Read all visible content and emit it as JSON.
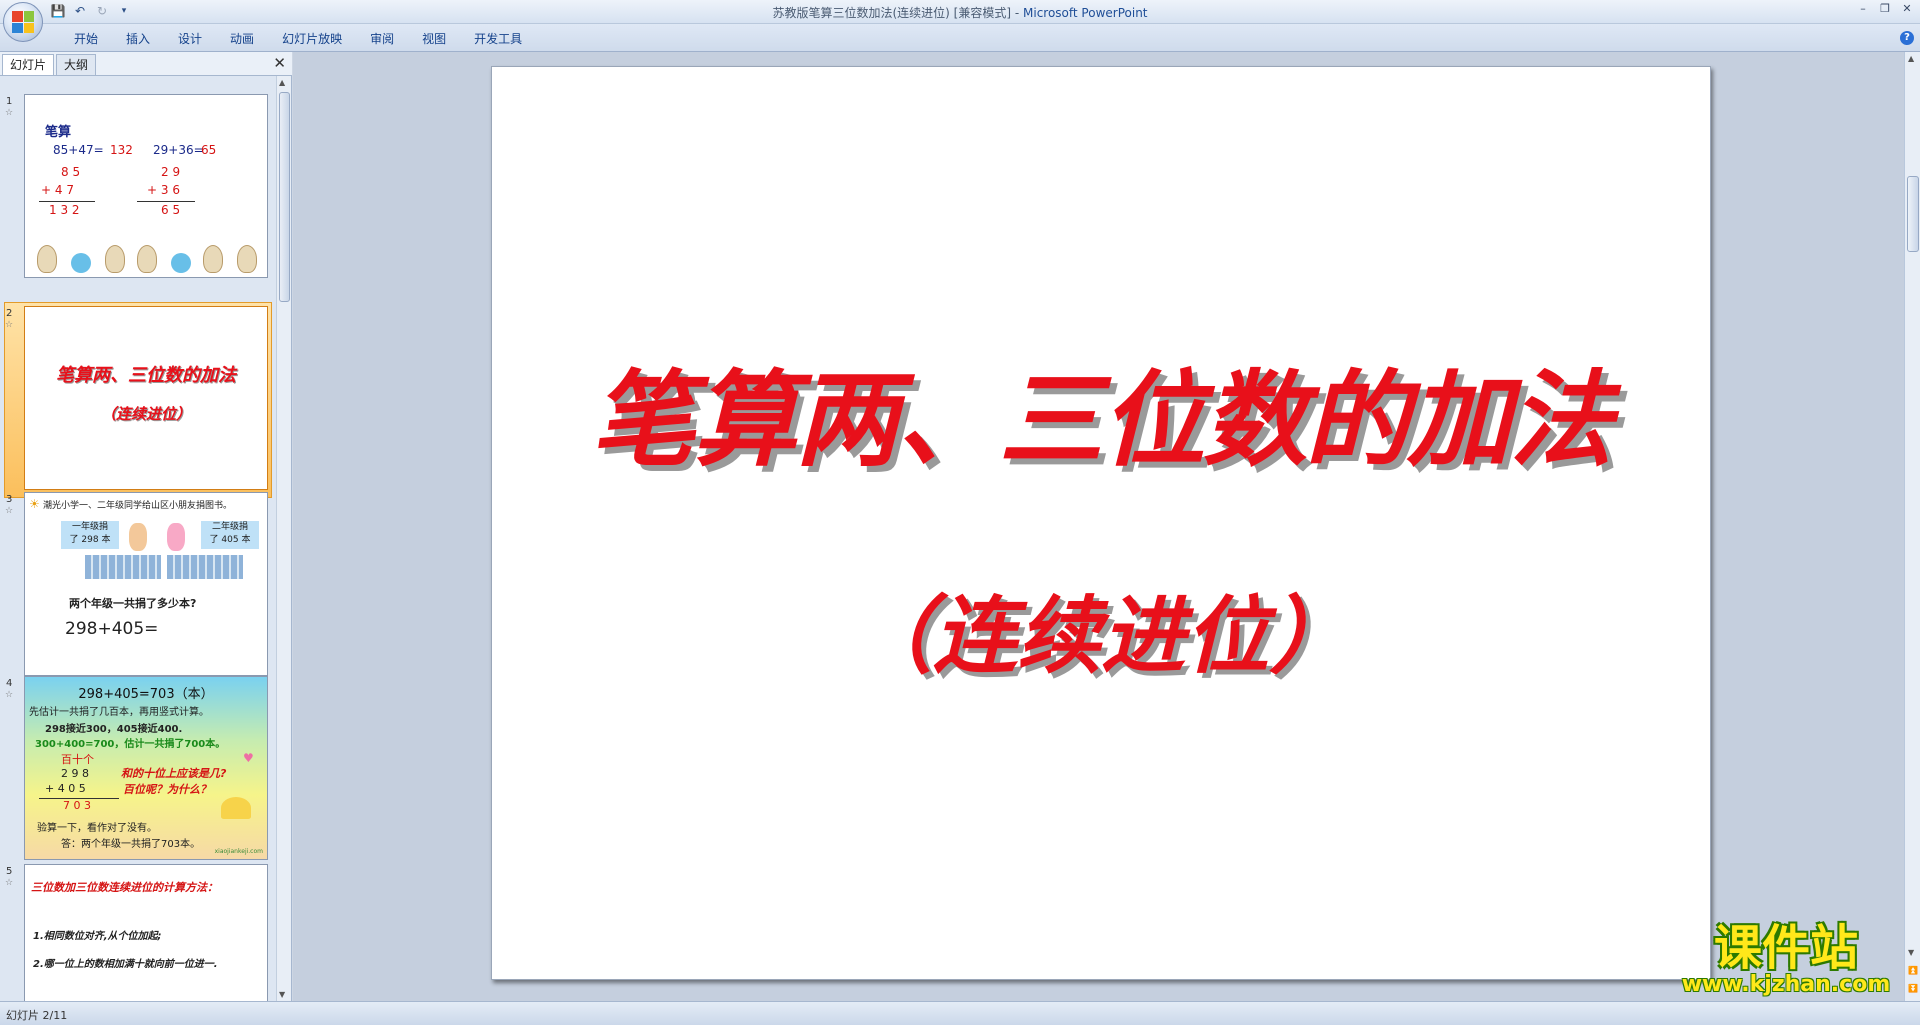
{
  "window": {
    "title": "苏教版笔算三位数加法(连续进位) [兼容模式] - ",
    "app_name": "Microsoft PowerPoint"
  },
  "qat": {
    "icons": [
      "save-icon",
      "undo-icon",
      "redo-icon",
      "customize-qat-icon"
    ]
  },
  "ribbon": {
    "tabs": [
      "开始",
      "插入",
      "设计",
      "动画",
      "幻灯片放映",
      "审阅",
      "视图",
      "开发工具"
    ]
  },
  "left_pane": {
    "tab_slides": "幻灯片",
    "tab_outline": "大纲",
    "thumbs": [
      {
        "num": "1",
        "title": "笔算",
        "eq1": "85+47=",
        "ans1": "132",
        "eq2": "29+36=",
        "ans2": "65",
        "col1": [
          "8 5",
          "+ 4 7",
          "1 3 2"
        ],
        "col2": [
          "2 9",
          "+ 3 6",
          "6 5"
        ]
      },
      {
        "num": "2",
        "title": "笔算两、三位数的加法",
        "sub": "（连续进位）"
      },
      {
        "num": "3",
        "header": "潮光小学一、二年级同学给山区小朋友捐图书。",
        "tag1a": "一年级捐",
        "tag1b": "了 298 本",
        "tag2a": "二年级捐",
        "tag2b": "了 405 本",
        "question": "两个年级一共捐了多少本?",
        "equation": "298+405="
      },
      {
        "num": "4",
        "line1": "298+405=703（本）",
        "line2": "先估计一共捐了几百本，再用竖式计算。",
        "line3": "298接近300，405接近400.",
        "line4": "300+400=700，估计一共捐了700本。",
        "place": "百十个",
        "r1": "2 9 8",
        "r2": "+ 4 0 5",
        "r3": "7 0 3",
        "q1": "和的十位上应该是几?",
        "q2": "百位呢？为什么？",
        "check": "验算一下，看作对了没有。",
        "answer": "答：两个年级一共捐了703本。",
        "site": "xiaojiankeji.com"
      },
      {
        "num": "5",
        "title": "三位数加三位数连续进位的计算方法：",
        "p1": "1.相同数位对齐,从个位加起;",
        "p2": "2.哪一位上的数相加满十就向前一位进一."
      }
    ]
  },
  "slide": {
    "title": "笔算两、三位数的加法",
    "subtitle": "（连续进位）"
  },
  "watermark": {
    "title": "课件站",
    "url": "www.kjzhan.com"
  },
  "status": {
    "text": "幻灯片 2/11"
  }
}
